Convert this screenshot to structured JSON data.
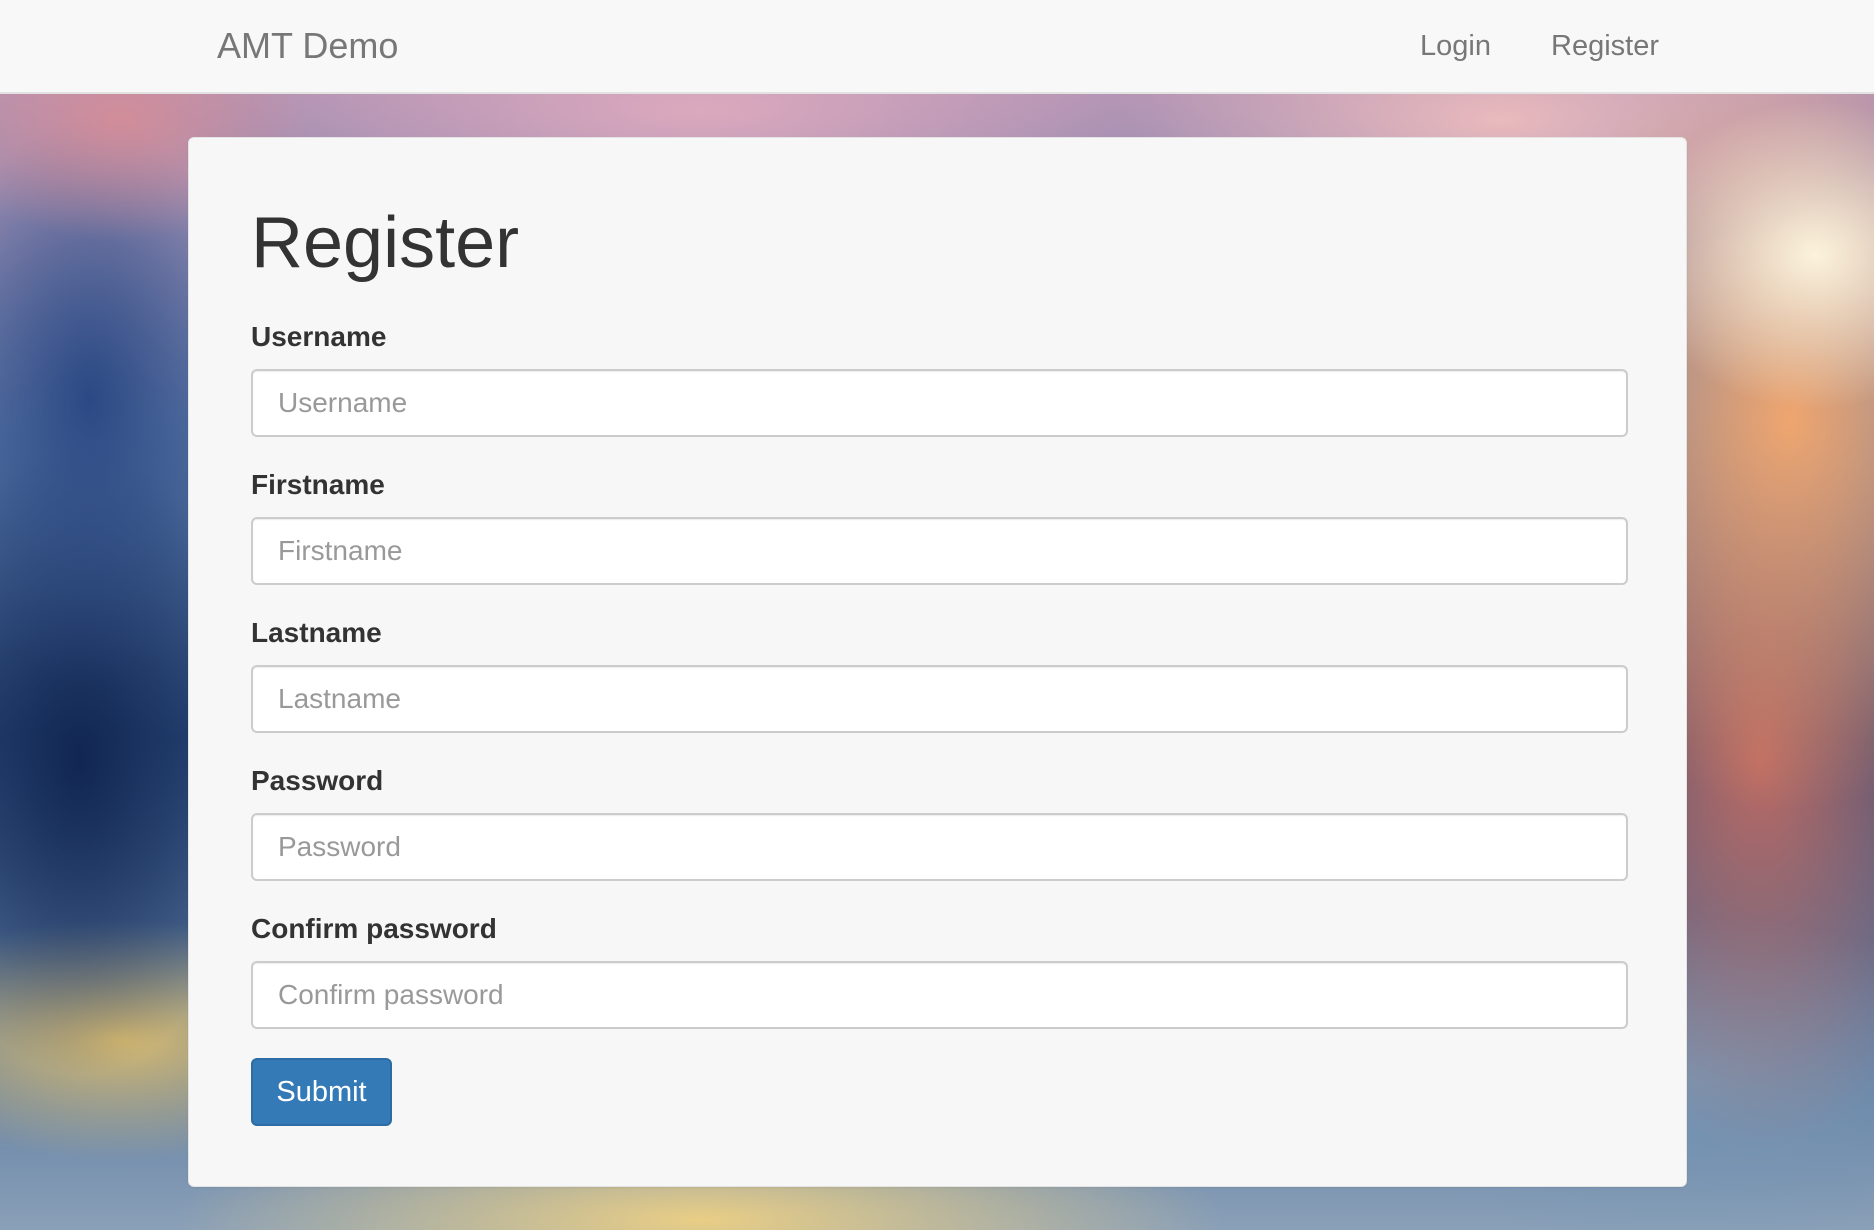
{
  "navbar": {
    "brand": "AMT Demo",
    "links": [
      {
        "label": "Login"
      },
      {
        "label": "Register"
      }
    ]
  },
  "form": {
    "title": "Register",
    "fields": [
      {
        "label": "Username",
        "placeholder": "Username",
        "value": ""
      },
      {
        "label": "Firstname",
        "placeholder": "Firstname",
        "value": ""
      },
      {
        "label": "Lastname",
        "placeholder": "Lastname",
        "value": ""
      },
      {
        "label": "Password",
        "placeholder": "Password",
        "value": ""
      },
      {
        "label": "Confirm password",
        "placeholder": "Confirm password",
        "value": ""
      }
    ],
    "submit_label": "Submit"
  },
  "colors": {
    "primary": "#337ab7",
    "navbar_bg": "#f8f8f8",
    "card_bg": "#f7f7f7",
    "text": "#333333",
    "muted": "#777777"
  }
}
